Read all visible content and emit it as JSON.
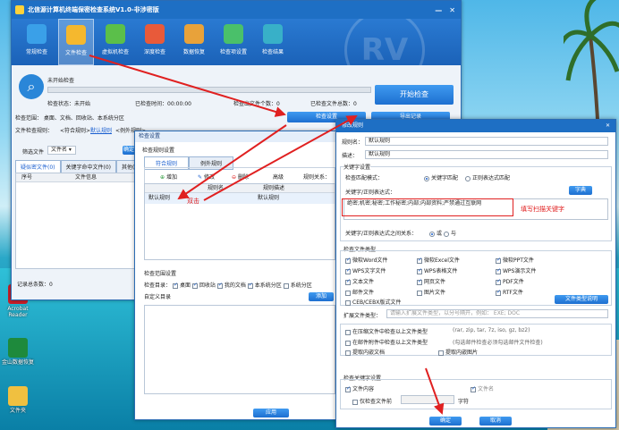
{
  "desktop": {
    "icons": [
      {
        "label": "Acrobat Reader",
        "color": "#c8202a"
      },
      {
        "label": "金山数据恢复",
        "color": "#1e8a3c"
      },
      {
        "label": "文件夹",
        "color": "#f0c040"
      }
    ]
  },
  "main": {
    "title": "北信源计算机终端保密检查系统V1.0-非涉密版",
    "window_buttons": {
      "minimize": "—",
      "close": "✕"
    },
    "toolbar": [
      {
        "label": "常规检查",
        "icon": "shield-icon",
        "color": "#3aa0e8"
      },
      {
        "label": "文件检查",
        "icon": "folder-icon",
        "color": "#f5b82e"
      },
      {
        "label": "虚拟机检查",
        "icon": "disc-icon",
        "color": "#5bbf4a"
      },
      {
        "label": "深度检查",
        "icon": "magnifier-icon",
        "color": "#e85a3a"
      },
      {
        "label": "数据恢复",
        "icon": "box-icon",
        "color": "#e8a23a"
      },
      {
        "label": "检查项设置",
        "icon": "gear-icon",
        "color": "#4ac06a"
      },
      {
        "label": "检查结果",
        "icon": "monitor-icon",
        "color": "#38b0c8"
      }
    ],
    "watermark": "RV",
    "scan": {
      "not_started": "未开始检查",
      "status": "检查状态：未开始",
      "check_time": "已检查时间：00:00:00",
      "checked_files": "检查出文件个数：0",
      "checked_total": "已检查文件总数：0",
      "start_button": "开始检查",
      "progress": 0
    },
    "scope": "检查范围：  桌面、文档、回收站、本系统分区",
    "rule_label": "文件检查规则：",
    "rule_sensitive": "<符合规则>",
    "rule_default": "默认规则",
    "rule_other": "<例外规则>",
    "settings_button": "检查设置",
    "export_button": "导出记录",
    "filter_label": "筛选文件",
    "filter_select": "文件名",
    "filter_button": "确定",
    "tabs": [
      "疑似密文件(0)",
      "关键字命中文件(0)",
      "其他(0)"
    ],
    "columns": [
      "序号",
      "文件信息"
    ],
    "record_total": "记录总条数：0"
  },
  "check_settings": {
    "title": "检查设置",
    "rule_section": "检查规则设置",
    "tabs": [
      "符合规则",
      "例外规则"
    ],
    "add": "增加",
    "edit": "修改",
    "delete": "删除",
    "advanced": "高级",
    "rule_relation": "规则关系：",
    "columns": [
      "规则名",
      "规则描述"
    ],
    "rows": [
      {
        "name": "默认规则",
        "desc": "默认规则"
      }
    ],
    "dbl_click": "双击",
    "scope_section": "检查范围设置",
    "scope_label": "检查目录：",
    "scope_items": [
      {
        "label": "桌面",
        "checked": true
      },
      {
        "label": "回收站",
        "checked": true
      },
      {
        "label": "我的文档",
        "checked": true
      },
      {
        "label": "本系统分区",
        "checked": true
      },
      {
        "label": "系统分区",
        "checked": false
      }
    ],
    "custom_dir": "自定义目录",
    "add_button": "添加",
    "apply_button": "应用"
  },
  "rule_dialog": {
    "title": "修改规则",
    "name_label": "规则名：",
    "name_value": "默认规则",
    "desc_label": "描述：",
    "desc_value": "默认规则",
    "kw_section": "关键字设置",
    "match_mode_label": "检查匹配模式：",
    "match_keyword": "关键字匹配",
    "match_regex": "正则表达式匹配",
    "kw_label": "关键字/正则表达式：",
    "dict_button": "字典",
    "keywords": "绝密;机密;秘密;工作秘密;内部;内部资料;严禁通过互联网",
    "hint": "填写扫描关键字",
    "relation_label": "关键字/正则表达式之间关系：",
    "rel_or": "或",
    "rel_and": "与",
    "type_section": "检查文件类型",
    "types": [
      {
        "label": "微软Word文件",
        "checked": true
      },
      {
        "label": "微软Excel文件",
        "checked": true
      },
      {
        "label": "微软PPT文件",
        "checked": true
      },
      {
        "label": "WPS文字文件",
        "checked": true
      },
      {
        "label": "WPS表格文件",
        "checked": true
      },
      {
        "label": "WPS演示文件",
        "checked": true
      },
      {
        "label": "文本文件",
        "checked": true
      },
      {
        "label": "网页文件",
        "checked": true
      },
      {
        "label": "PDF文件",
        "checked": true
      },
      {
        "label": "邮件文件",
        "checked": false
      },
      {
        "label": "图片文件",
        "checked": false
      },
      {
        "label": "RTF文件",
        "checked": true
      },
      {
        "label": "CEB/CEBX版式文件",
        "checked": false
      }
    ],
    "type_explain_button": "文件类型说明",
    "ext_label": "扩展文件类型：",
    "ext_placeholder": "请输入扩展文件类型，以分号隔开，例如： EXE; DOC",
    "compress_label": "在压缩文件中检查以上文件类型",
    "compress_hint": "(rar, zip, tar, 7z, iso, gz, bz2)",
    "mail_attach_label": "在邮件附件中检查以上文件类型",
    "mail_attach_hint": "(勾选邮件检查必须勾选邮件文件检查)",
    "embedded_label": "提取内嵌文档",
    "image_extract_label": "提取内嵌图片",
    "kw_check_section": "检查关键字设置",
    "file_content": "文件内容",
    "file_name": "文件名",
    "only_prefix": "仅检查文件前",
    "chars": "字符",
    "ok": "确定",
    "cancel": "取消"
  }
}
